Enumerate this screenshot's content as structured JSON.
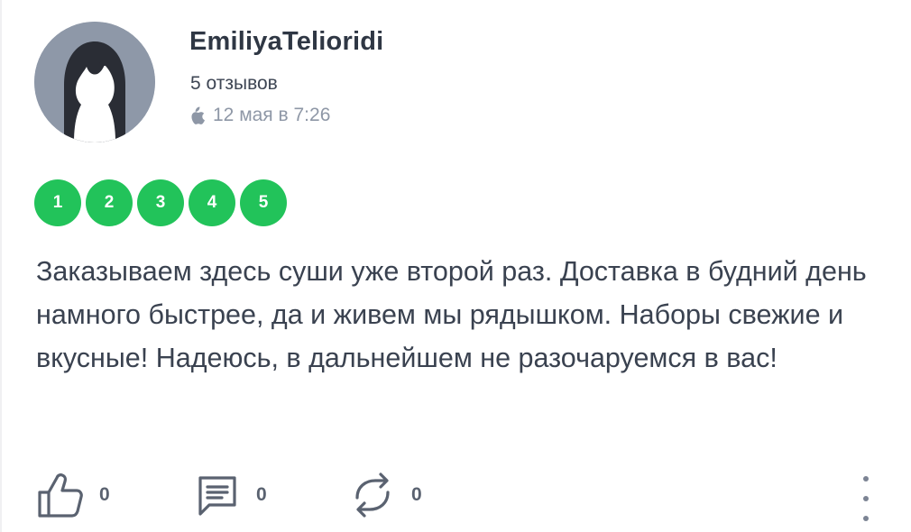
{
  "author": {
    "name": "EmiliyaTelioridi",
    "reviews_count": "5 отзывов",
    "date": "12 мая в 7:26",
    "platform_icon": "apple-icon",
    "avatar_icon": "user-silhouette-avatar"
  },
  "rating": {
    "value": 5,
    "max": 5,
    "labels": [
      "1",
      "2",
      "3",
      "4",
      "5"
    ],
    "color": "#22c35a"
  },
  "review": {
    "text": "Заказываем здесь суши уже второй раз. Доставка в будний день намного быстрее, да и живем мы рядышком. Наборы свежие и вкусные! Надеюсь, в дальнейшем не разочаруемся в вас!"
  },
  "actions": {
    "likes": "0",
    "comments": "0",
    "reposts": "0",
    "like_icon": "thumbs-up-icon",
    "comment_icon": "comment-icon",
    "repost_icon": "repost-icon",
    "more_icon": "more-vertical-icon"
  }
}
